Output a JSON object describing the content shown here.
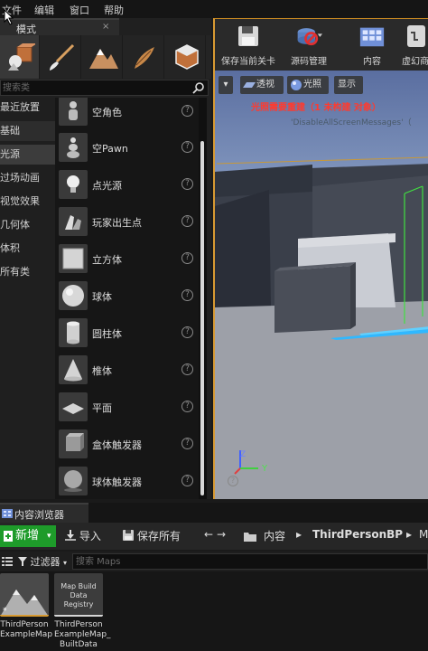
{
  "menu": [
    "文件",
    "编辑",
    "窗口",
    "帮助"
  ],
  "modes_panel": {
    "tab_title": "模式",
    "close": "×",
    "search_placeholder": "搜索类",
    "categories": [
      "最近放置",
      "基础",
      "光源",
      "过场动画",
      "视觉效果",
      "几何体",
      "体积",
      "所有类"
    ],
    "assets": [
      {
        "label": "空角色",
        "icon": "empty-character-icon"
      },
      {
        "label": "空Pawn",
        "icon": "empty-pawn-icon"
      },
      {
        "label": "点光源",
        "icon": "point-light-icon"
      },
      {
        "label": "玩家出生点",
        "icon": "player-start-icon"
      },
      {
        "label": "立方体",
        "icon": "cube-icon"
      },
      {
        "label": "球体",
        "icon": "sphere-icon"
      },
      {
        "label": "圆柱体",
        "icon": "cylinder-icon"
      },
      {
        "label": "椎体",
        "icon": "cone-icon"
      },
      {
        "label": "平面",
        "icon": "plane-icon"
      },
      {
        "label": "盒体触发器",
        "icon": "box-trigger-icon"
      },
      {
        "label": "球体触发器",
        "icon": "sphere-trigger-icon"
      }
    ],
    "help_glyph": "?"
  },
  "toolbar": {
    "save_level": "保存当前关卡",
    "source_control": "源码管理",
    "content": "内容",
    "marketplace": "虚幻商"
  },
  "viewport": {
    "menu_arrow": "▾",
    "perspective": "透视",
    "lit": "光照",
    "show": "显示",
    "warning": "光照需要重建（1 未构建 对象）",
    "debug": "'DisableAllScreenMessages'（",
    "axis_x": "Y",
    "axis_z": "Z"
  },
  "content_browser": {
    "tab_title": "内容浏览器",
    "new_label": "新增",
    "import_label": "导入",
    "save_all_label": "保存所有",
    "path": [
      "内容",
      "ThirdPersonBP",
      "M"
    ],
    "filter_label": "过滤器",
    "search_placeholder": "搜索 Maps",
    "assets": [
      {
        "name": "ThirdPerson ExampleMap",
        "thumb_text": ""
      },
      {
        "name": "ThirdPerson ExampleMap_ BuiltData",
        "thumb_text": "Map Build Data Registry"
      }
    ]
  },
  "colors": {
    "accent_orange": "#d89a32",
    "new_button_green": "#1e9b2a",
    "warning_red": "#ff3a2e",
    "sky_blue": "#5f72a0"
  }
}
